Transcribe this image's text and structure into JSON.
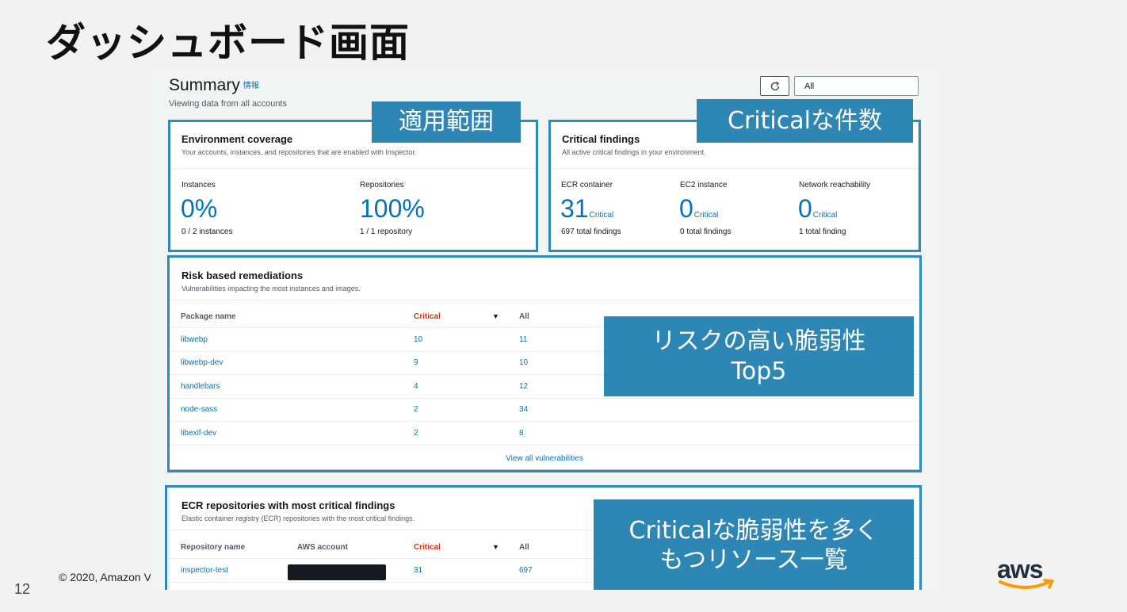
{
  "slide": {
    "title": "ダッシュボード画面",
    "page_number": "12",
    "copyright": "© 2020, Amazon V",
    "logo_text": "aws"
  },
  "header": {
    "title": "Summary",
    "info_link": "情報",
    "subtitle": "Viewing data from all accounts",
    "search_value": "All"
  },
  "coverage": {
    "title": "Environment coverage",
    "description": "Your accounts, instances, and repositories that are enabled with Inspector.",
    "instances_label": "Instances",
    "instances_value": "0%",
    "instances_detail": "0 / 2 instances",
    "repos_label": "Repositories",
    "repos_value": "100%",
    "repos_detail": "1 / 1 repository"
  },
  "critical": {
    "title": "Critical findings",
    "description": "All active critical findings in your environment.",
    "items": [
      {
        "label": "ECR container",
        "value": "31",
        "suffix": "Critical",
        "detail": "697 total findings"
      },
      {
        "label": "EC2 instance",
        "value": "0",
        "suffix": "Critical",
        "detail": "0 total findings"
      },
      {
        "label": "Network reachability",
        "value": "0",
        "suffix": "Critical",
        "detail": "1 total finding"
      }
    ]
  },
  "risk": {
    "title": "Risk based remediations",
    "description": "Vulnerabilities impacting the most instances and images.",
    "col_package": "Package name",
    "col_critical": "Critical",
    "col_all": "All",
    "rows": [
      {
        "name": "libwebp",
        "critical": "10",
        "all": "11"
      },
      {
        "name": "libwebp-dev",
        "critical": "9",
        "all": "10"
      },
      {
        "name": "handlebars",
        "critical": "4",
        "all": "12"
      },
      {
        "name": "node-sass",
        "critical": "2",
        "all": "34"
      },
      {
        "name": "libexif-dev",
        "critical": "2",
        "all": "8"
      }
    ],
    "view_all": "View all vulnerabilities"
  },
  "ecr": {
    "title": "ECR repositories with most critical findings",
    "description": "Elastic container registry (ECR) repositories with the most critical findings.",
    "col_repo": "Repository name",
    "col_account": "AWS account",
    "col_critical": "Critical",
    "col_all": "All",
    "rows": [
      {
        "name": "inspector-test",
        "critical": "31",
        "all": "697"
      }
    ]
  },
  "callouts": {
    "coverage": "適用範囲",
    "critical": "Criticalな件数",
    "risk_line1": "リスクの高い脆弱性",
    "risk_line2": "Top5",
    "ecr_line1": "Criticalな脆弱性を多く",
    "ecr_line2": "もつリソース一覧"
  },
  "colors": {
    "link": "#0073bb",
    "critical_header": "#d13212",
    "callout_bg": "#2e86b5",
    "highlight_border": "#2e8bb8"
  }
}
